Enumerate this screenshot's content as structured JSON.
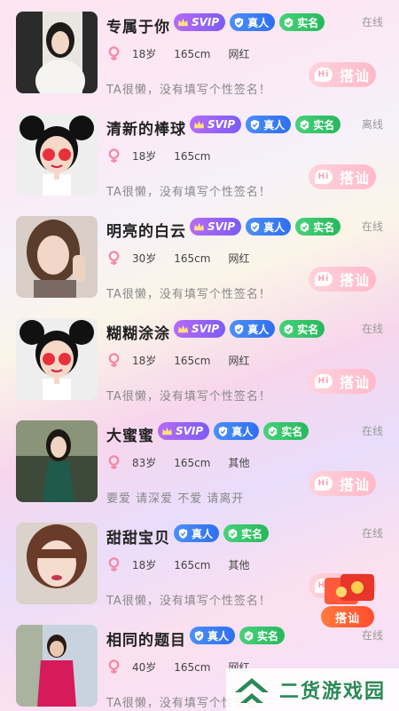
{
  "users": [
    {
      "name": "专属于你",
      "badges": [
        "SVIP",
        "真人",
        "实名"
      ],
      "status": "在线",
      "age": "18岁",
      "height": "165cm",
      "tag": "网红",
      "signature": "TA很懒，没有填写个性签名！",
      "chat_label": "搭讪",
      "avatar": "photo-girl-fur"
    },
    {
      "name": "清新的棒球",
      "badges": [
        "SVIP",
        "真人",
        "实名"
      ],
      "status": "离线",
      "age": "18岁",
      "height": "165cm",
      "tag": "",
      "signature": "TA很懒，没有填写个性签名！",
      "chat_label": "搭讪",
      "avatar": "cartoon-mouse-girl"
    },
    {
      "name": "明亮的白云",
      "badges": [
        "SVIP",
        "真人",
        "实名"
      ],
      "status": "在线",
      "age": "30岁",
      "height": "165cm",
      "tag": "网红",
      "signature": "TA很懒，没有填写个性签名！",
      "chat_label": "搭讪",
      "avatar": "photo-girl-peace"
    },
    {
      "name": "糊糊涂涂",
      "badges": [
        "SVIP",
        "真人",
        "实名"
      ],
      "status": "在线",
      "age": "18岁",
      "height": "165cm",
      "tag": "网红",
      "signature": "TA很懒，没有填写个性签名！",
      "chat_label": "搭讪",
      "avatar": "cartoon-mouse-girl"
    },
    {
      "name": "大蜜蜜",
      "badges": [
        "SVIP",
        "真人",
        "实名"
      ],
      "status": "在线",
      "age": "83岁",
      "height": "165cm",
      "tag": "其他",
      "signature": "要爱  请深爱  不爱  请离开",
      "chat_label": "搭讪",
      "avatar": "photo-girl-green"
    },
    {
      "name": "甜甜宝贝",
      "badges": [
        "真人",
        "实名"
      ],
      "status": "在线",
      "age": "18岁",
      "height": "165cm",
      "tag": "其他",
      "signature": "TA很懒，没有填写个性签名！",
      "chat_label": "搭讪",
      "avatar": "photo-girl-makeup"
    },
    {
      "name": "相同的题目",
      "badges": [
        "真人",
        "实名"
      ],
      "status": "在线",
      "age": "40岁",
      "height": "165cm",
      "tag": "网红",
      "signature": "TA很懒，没有填写个性签名！",
      "chat_label": "搭讪",
      "avatar": "photo-woman-red"
    }
  ],
  "floating": {
    "label": "搭讪",
    "icon": "red-envelope-icon"
  },
  "watermark": {
    "text": "二货游戏园",
    "icon": "double-chevron-logo"
  },
  "colors": {
    "svip": "#8e5cf6",
    "real": "#3f80f6",
    "ident": "#35c66b",
    "chat_button": "#ffc2d0",
    "gender_icon": "#f28aa5"
  }
}
